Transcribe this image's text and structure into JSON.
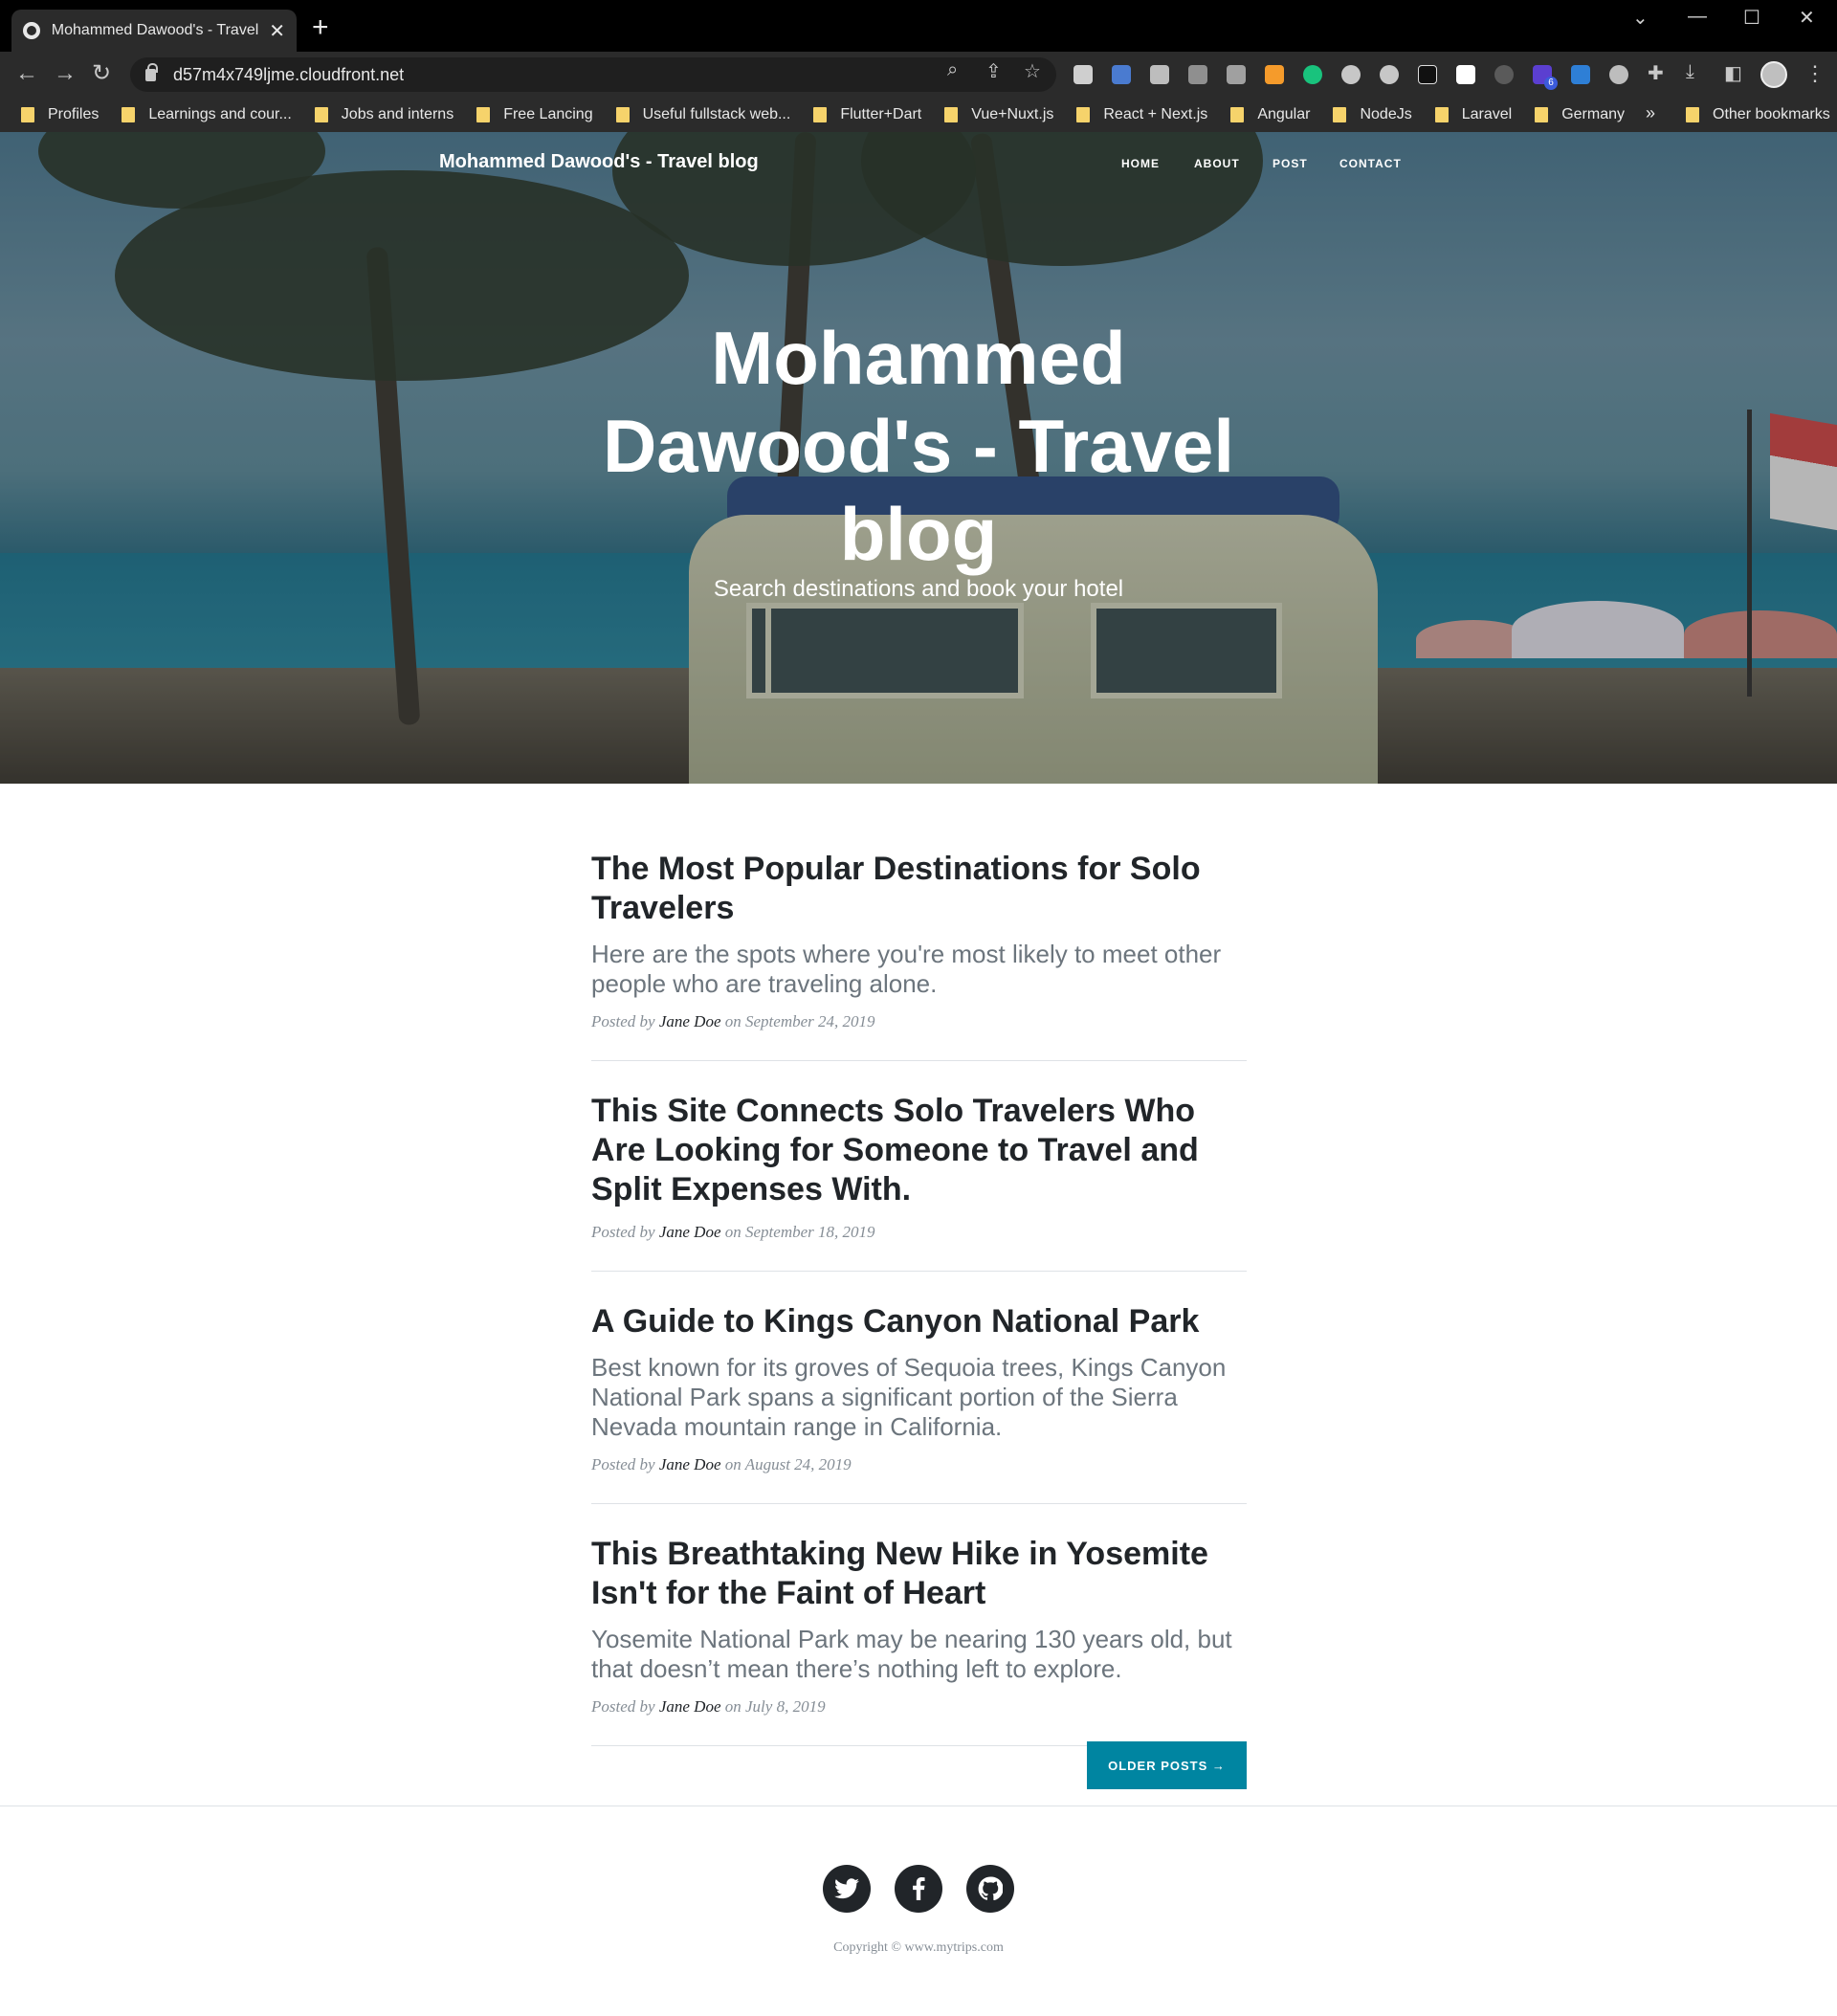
{
  "browser": {
    "tab_title": "Mohammed Dawood's - Travel bl",
    "url": "d57m4x749ljme.cloudfront.net",
    "extension_badge": "6",
    "bookmarks": [
      "Profiles",
      "Learnings and cour...",
      "Jobs and interns",
      "Free Lancing",
      "Useful fullstack web...",
      "Flutter+Dart",
      "Vue+Nuxt.js",
      "React + Next.js",
      "Angular",
      "NodeJs",
      "Laravel",
      "Germany"
    ],
    "overflow_glyph": "»",
    "other_bookmarks": "Other bookmarks"
  },
  "site": {
    "brand": "Mohammed Dawood's - Travel blog",
    "nav": [
      "HOME",
      "ABOUT",
      "POST",
      "CONTACT"
    ],
    "hero_title": "Mohammed Dawood's - Travel blog",
    "hero_subtitle": "Search destinations and book your hotel"
  },
  "posts": [
    {
      "title": "The Most Popular Destinations for Solo Travelers",
      "excerpt": "Here are the spots where you're most likely to meet other people who are traveling alone.",
      "posted_by": "Posted by",
      "author": "Jane Doe",
      "date": "on September 24, 2019"
    },
    {
      "title": "This Site Connects Solo Travelers Who Are Looking for Someone to Travel and Split Expenses With.",
      "excerpt": "",
      "posted_by": "Posted by",
      "author": "Jane Doe",
      "date": "on September 18, 2019"
    },
    {
      "title": "A Guide to Kings Canyon National Park",
      "excerpt": "Best known for its groves of Sequoia trees, Kings Canyon National Park spans a significant portion of the Sierra Nevada mountain range in California.",
      "posted_by": "Posted by",
      "author": "Jane Doe",
      "date": "on August 24, 2019"
    },
    {
      "title": "This Breathtaking New Hike in Yosemite Isn't for the Faint of Heart",
      "excerpt": "Yosemite National Park may be nearing 130 years old, but that doesn’t mean there’s nothing left to explore.",
      "posted_by": "Posted by",
      "author": "Jane Doe",
      "date": "on July 8, 2019"
    }
  ],
  "older_posts": "OLDER POSTS →",
  "footer": {
    "social": [
      "twitter-icon",
      "facebook-icon",
      "github-icon"
    ],
    "copyright": "Copyright © www.mytrips.com"
  },
  "colors": {
    "accent": "#0085a1",
    "heading": "#212529",
    "muted": "#868e96"
  }
}
